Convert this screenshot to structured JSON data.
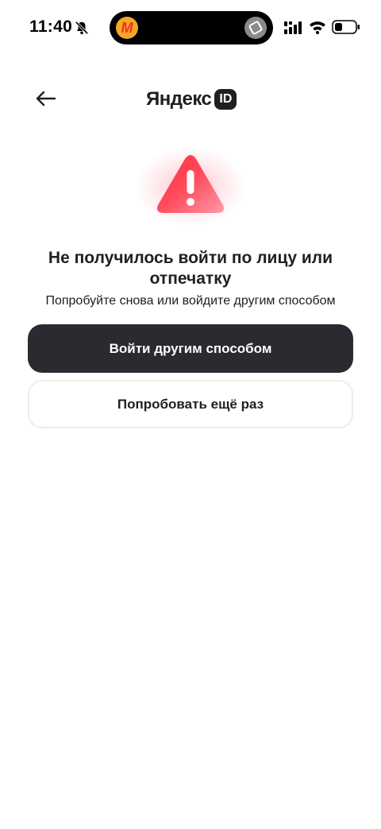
{
  "status_bar": {
    "time": "11:40",
    "island_app_letter": "M",
    "icons": [
      "bell-off-icon",
      "cellular-signal-icon",
      "wifi-icon",
      "battery-icon"
    ]
  },
  "header": {
    "brand_name": "Яндекс",
    "brand_badge": "ID",
    "back_icon": "arrow-left-icon"
  },
  "illustration": {
    "icon": "warning-triangle-icon",
    "accent": "#ff3d5a"
  },
  "main": {
    "title": "Не получилось войти по лицу или отпечатку",
    "subtitle": "Попробуйте снова или войдите другим способом"
  },
  "actions": {
    "primary_label": "Войти другим способом",
    "secondary_label": "Попробовать ещё раз"
  },
  "colors": {
    "primary_button": "#2b2a31",
    "text": "#21201f"
  }
}
